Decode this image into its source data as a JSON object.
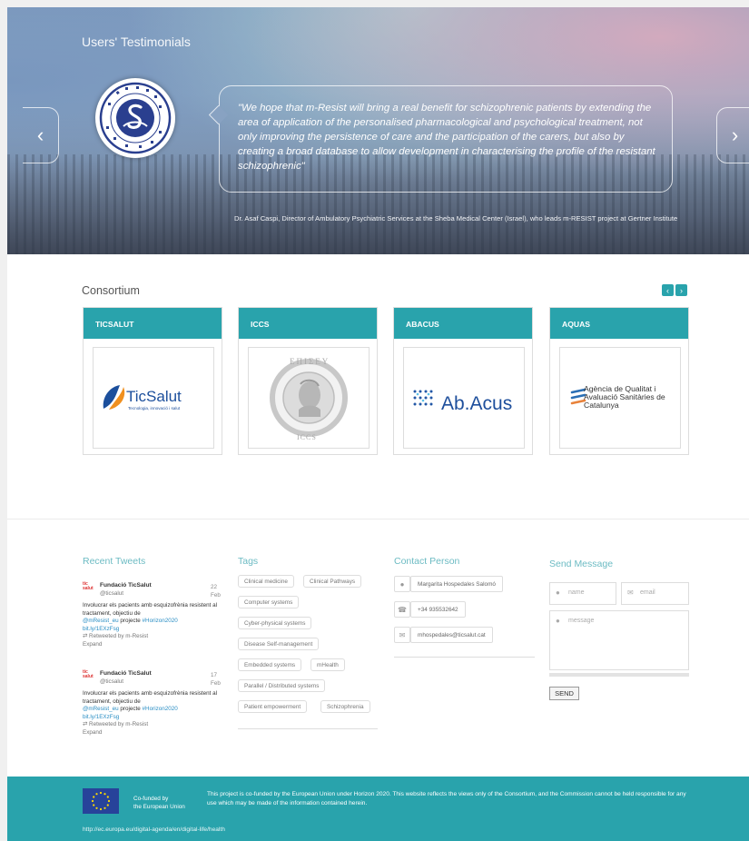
{
  "testimonials": {
    "title": "Users' Testimonials",
    "quote": "\"We hope that m-Resist will bring a real benefit for schizophrenic patients by extending the area of application of the personalised pharmacological and psychological treatment, not only improving the persistence of care and the participation of the carers, but also by creating a broad database to allow development in characterising the profile of the resistant schizophrenic\"",
    "author": "Dr. Asaf Caspi, Director of Ambulatory Psychiatric Services at the Sheba Medical Center (Israel), who leads m-RESIST project at Gertner Institute",
    "prev_glyph": "‹",
    "next_glyph": "›"
  },
  "consortium": {
    "title": "Consortium",
    "prev_glyph": "‹",
    "next_glyph": "›",
    "cards": [
      {
        "name": "TICSALUT",
        "logo_text": "TicSalut",
        "logo_sub": "Tecnologia, innovació i salut"
      },
      {
        "name": "ICCS",
        "logo_text": "ICCS",
        "logo_sub": "ΕΠΙΣΕΥ"
      },
      {
        "name": "ABACUS",
        "logo_text": "Ab.Acus",
        "logo_sub": ""
      },
      {
        "name": "AQUAS",
        "logo_text": "Agència de Qualitat i Avaluació Sanitàries de Catalunya",
        "logo_sub": ""
      }
    ]
  },
  "tweets": {
    "title": "Recent Tweets",
    "items": [
      {
        "logo": "tic salut",
        "name": "Fundació TicSalut",
        "handle": "@ticsalut",
        "date": "22 Feb",
        "text": "Involucrar els pacients amb esquizofrènia resistent al tractament, objectiu de",
        "mention": "@mResist_eu",
        "text2": "projecte",
        "hashtag": "#Horizon2020",
        "link": "bit.ly/1EXzFsg",
        "retweet": "Retweeted by m-Resist",
        "expand": "Expand"
      },
      {
        "logo": "tic salut",
        "name": "Fundació TicSalut",
        "handle": "@ticsalut",
        "date": "17 Feb",
        "text": "Involucrar els pacients amb esquizofrènia resistent al tractament, objectiu de",
        "mention": "@mResist_eu",
        "text2": "projecte",
        "hashtag": "#Horizon2020",
        "link": "bit.ly/1EXzFsg",
        "retweet": "Retweeted by m-Resist",
        "expand": "Expand"
      }
    ]
  },
  "tags": {
    "title": "Tags",
    "items": [
      "Clinical medicine",
      "Clinical Pathways",
      "Computer systems",
      "Cyber-physical systems",
      "Disease Self-management",
      "Embedded systems",
      "mHealth",
      "Parallel / Distributed systems",
      "Patient empowerment",
      "Schizophrenia"
    ]
  },
  "contact": {
    "title": "Contact Person",
    "name": "Margarita Hospedales Salomó",
    "phone": "+34 935532642",
    "email": "mhospedales@ticsalut.cat"
  },
  "message": {
    "title": "Send Message",
    "name_placeholder": "name",
    "email_placeholder": "email",
    "message_placeholder": "message",
    "send_label": "SEND"
  },
  "footer": {
    "cofunded_line1": "Co-funded by",
    "cofunded_line2": "the European Union",
    "disclaimer": "This project is co-funded by the European Union under Horizon 2020. This website reflects the views only of the Consortium, and the Commission cannot be held responsible for any use which may be made of the information contained herein.",
    "link": "http://ec.europa.eu/digital-agenda/en/digital-life/health"
  },
  "colors": {
    "accent": "#29a3ac",
    "link": "#2a8ec4"
  }
}
